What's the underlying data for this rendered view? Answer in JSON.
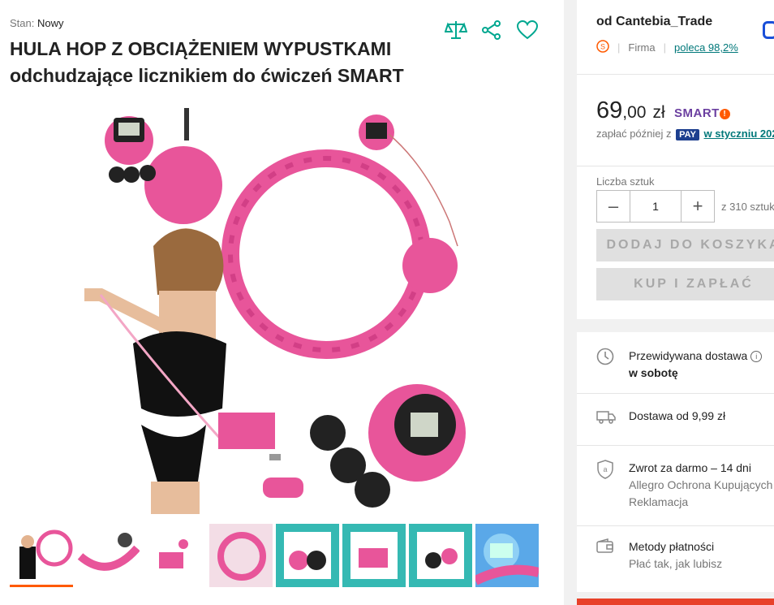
{
  "product": {
    "condition_label": "Stan:",
    "condition_value": "Nowy",
    "title": "HULA HOP Z OBCIĄŻENIEM WYPUSTKAMI odchudzające licznikiem do ćwiczeń SMART"
  },
  "header_icons": [
    "compare-scales-icon",
    "share-icon",
    "heart-icon"
  ],
  "gallery": {
    "thumbnail_count": 8,
    "selected_index": 0
  },
  "seller": {
    "name": "od Cantebia_Trade",
    "type": "Firma",
    "recommend": "poleca 98,2%"
  },
  "price": {
    "int": "69",
    "dec": ",00",
    "currency": "zł",
    "smart": "SMART"
  },
  "pay_later": {
    "prefix": "zapłać później z",
    "badge": "PAY",
    "link": "w styczniu 202"
  },
  "quantity": {
    "label": "Liczba sztuk",
    "value": "1",
    "of": "z 310 sztuk"
  },
  "buttons": {
    "add_to_cart": "DODAJ DO KOSZYKA",
    "buy_now": "KUP I ZAPŁAĆ"
  },
  "delivery": {
    "expected_label": "Przewidywana dostawa",
    "expected_value": "w sobotę",
    "cost": "Dostawa od 9,99 zł",
    "return_title": "Zwrot za darmo – 14 dni",
    "return_sub1": "Allegro Ochrona Kupujących",
    "return_sub2": "Reklamacja",
    "payment_title": "Metody płatności",
    "payment_sub": "Płać tak, jak lubisz"
  },
  "colors": {
    "accent": "#00a790",
    "brand_orange": "#ff5a00",
    "product_pink": "#e8559a"
  }
}
